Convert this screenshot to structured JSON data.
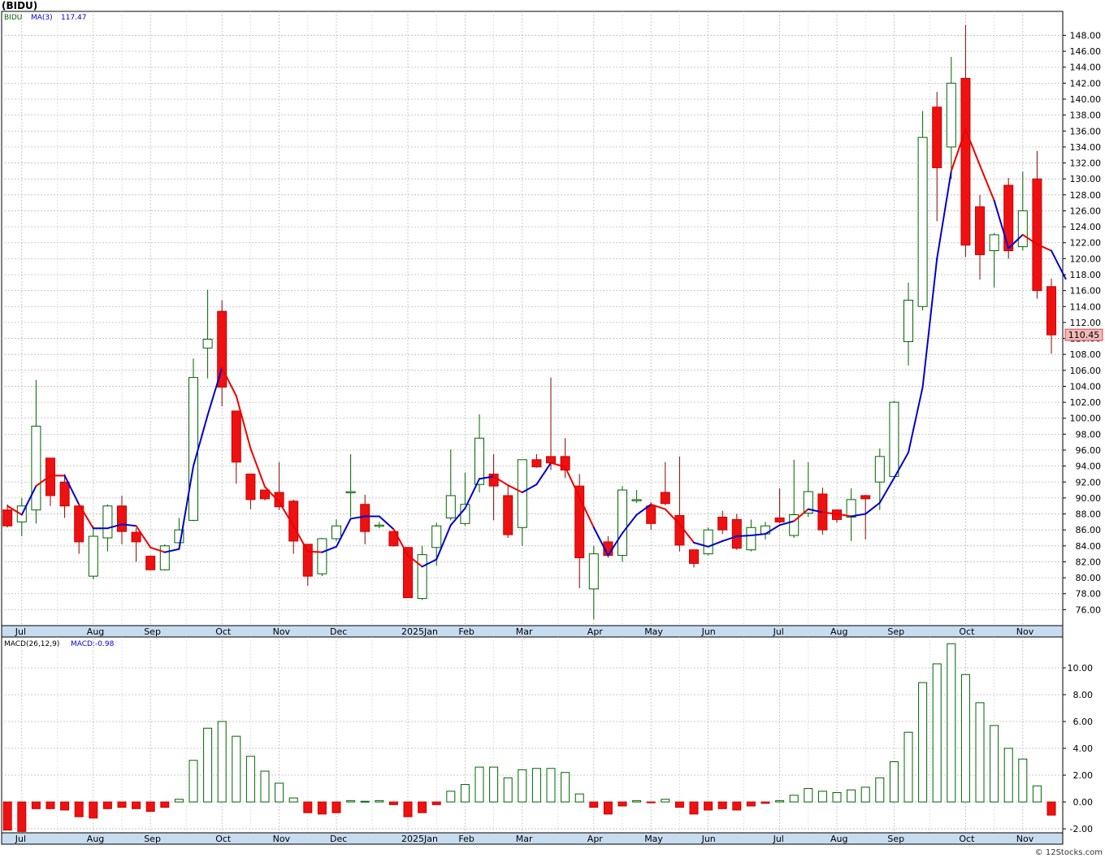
{
  "chart_data": [
    {
      "type": "candlestick",
      "title": "(BIDU)",
      "legend": [
        {
          "label": "BIDU",
          "color": "#006400"
        },
        {
          "label": "MA(3)",
          "color": "#0000cc"
        },
        {
          "label": "117.47",
          "color": "#0000cc"
        }
      ],
      "last_price_label": "110.45",
      "ylim": [
        74,
        151
      ],
      "yticks": [
        76,
        78,
        80,
        82,
        84,
        86,
        88,
        90,
        92,
        94,
        96,
        98,
        100,
        102,
        104,
        106,
        108,
        110,
        112,
        114,
        116,
        118,
        120,
        122,
        124,
        126,
        128,
        130,
        132,
        134,
        136,
        138,
        140,
        142,
        144,
        146,
        148
      ],
      "ytick_labels": [
        "76.00",
        "78.00",
        "80.00",
        "82.00",
        "84.00",
        "86.00",
        "88.00",
        "90.00",
        "92.00",
        "94.00",
        "96.00",
        "98.00",
        "100.00",
        "102.00",
        "104.00",
        "106.00",
        "108.00",
        "110.00",
        "112.00",
        "114.00",
        "116.00",
        "118.00",
        "120.00",
        "122.00",
        "124.00",
        "126.00",
        "128.00",
        "130.00",
        "132.00",
        "134.00",
        "136.00",
        "138.00",
        "140.00",
        "142.00",
        "144.00",
        "146.00",
        "148.00"
      ],
      "months": [
        {
          "label": "Jul",
          "index": 1
        },
        {
          "label": "Aug",
          "index": 6
        },
        {
          "label": "Sep",
          "index": 10
        },
        {
          "label": "Oct",
          "index": 15
        },
        {
          "label": "Nov",
          "index": 19
        },
        {
          "label": "Dec",
          "index": 23
        },
        {
          "label": "2025Jan",
          "index": 28
        },
        {
          "label": "Feb",
          "index": 32
        },
        {
          "label": "Mar",
          "index": 36
        },
        {
          "label": "Apr",
          "index": 41
        },
        {
          "label": "May",
          "index": 45
        },
        {
          "label": "Jun",
          "index": 49
        },
        {
          "label": "Jul",
          "index": 54
        },
        {
          "label": "Aug",
          "index": 58
        },
        {
          "label": "Sep",
          "index": 62
        },
        {
          "label": "Oct",
          "index": 67
        },
        {
          "label": "Nov",
          "index": 71
        }
      ],
      "candles": [
        {
          "o": 88.5,
          "h": 89.2,
          "l": 86.3,
          "c": 86.5
        },
        {
          "o": 87.0,
          "h": 90.0,
          "l": 85.2,
          "c": 89.0
        },
        {
          "o": 88.5,
          "h": 104.8,
          "l": 86.8,
          "c": 99.0
        },
        {
          "o": 95.0,
          "h": 95.0,
          "l": 89.0,
          "c": 90.3
        },
        {
          "o": 92.0,
          "h": 93.0,
          "l": 87.5,
          "c": 89.0
        },
        {
          "o": 89.0,
          "h": 89.2,
          "l": 83.0,
          "c": 84.5
        },
        {
          "o": 80.2,
          "h": 86.5,
          "l": 79.8,
          "c": 85.2
        },
        {
          "o": 85.0,
          "h": 89.2,
          "l": 83.3,
          "c": 89.0
        },
        {
          "o": 89.0,
          "h": 90.3,
          "l": 84.2,
          "c": 85.8
        },
        {
          "o": 85.7,
          "h": 86.2,
          "l": 82.0,
          "c": 84.5
        },
        {
          "o": 82.7,
          "h": 82.8,
          "l": 81.0,
          "c": 81.0
        },
        {
          "o": 81.0,
          "h": 84.2,
          "l": 80.9,
          "c": 84.0
        },
        {
          "o": 84.4,
          "h": 87.5,
          "l": 84.3,
          "c": 86.0
        },
        {
          "o": 87.2,
          "h": 107.5,
          "l": 87.1,
          "c": 105.1
        },
        {
          "o": 108.8,
          "h": 116.1,
          "l": 105.0,
          "c": 109.9
        },
        {
          "o": 113.4,
          "h": 114.8,
          "l": 101.5,
          "c": 103.9
        },
        {
          "o": 100.9,
          "h": 100.9,
          "l": 91.8,
          "c": 94.5
        },
        {
          "o": 93.0,
          "h": 93.0,
          "l": 88.6,
          "c": 89.8
        },
        {
          "o": 91.0,
          "h": 91.0,
          "l": 89.7,
          "c": 89.9
        },
        {
          "o": 90.7,
          "h": 94.5,
          "l": 88.5,
          "c": 88.9
        },
        {
          "o": 89.6,
          "h": 89.8,
          "l": 83.0,
          "c": 84.6
        },
        {
          "o": 84.2,
          "h": 84.2,
          "l": 79.0,
          "c": 80.2
        },
        {
          "o": 80.5,
          "h": 85.0,
          "l": 80.2,
          "c": 84.9
        },
        {
          "o": 84.9,
          "h": 87.3,
          "l": 84.6,
          "c": 86.5
        },
        {
          "o": 90.8,
          "h": 95.5,
          "l": 87.6,
          "c": 90.8
        },
        {
          "o": 89.2,
          "h": 90.4,
          "l": 84.2,
          "c": 85.8
        },
        {
          "o": 86.5,
          "h": 87.0,
          "l": 86.2,
          "c": 86.6
        },
        {
          "o": 85.8,
          "h": 85.8,
          "l": 83.9,
          "c": 84.0
        },
        {
          "o": 83.8,
          "h": 83.8,
          "l": 77.5,
          "c": 77.5
        },
        {
          "o": 77.4,
          "h": 84.0,
          "l": 77.2,
          "c": 82.9
        },
        {
          "o": 83.8,
          "h": 86.9,
          "l": 81.5,
          "c": 86.5
        },
        {
          "o": 87.5,
          "h": 96.1,
          "l": 87.2,
          "c": 90.3
        },
        {
          "o": 86.8,
          "h": 93.2,
          "l": 86.5,
          "c": 89.2
        },
        {
          "o": 91.7,
          "h": 100.5,
          "l": 90.7,
          "c": 97.5
        },
        {
          "o": 93.0,
          "h": 95.5,
          "l": 87.2,
          "c": 91.5
        },
        {
          "o": 90.3,
          "h": 91.5,
          "l": 85.0,
          "c": 85.4
        },
        {
          "o": 86.3,
          "h": 94.8,
          "l": 84.0,
          "c": 94.8
        },
        {
          "o": 94.8,
          "h": 95.5,
          "l": 93.8,
          "c": 93.9
        },
        {
          "o": 95.2,
          "h": 105.1,
          "l": 93.5,
          "c": 94.4
        },
        {
          "o": 95.2,
          "h": 97.5,
          "l": 92.5,
          "c": 93.5
        },
        {
          "o": 91.5,
          "h": 93.0,
          "l": 78.7,
          "c": 82.5
        },
        {
          "o": 78.6,
          "h": 84.0,
          "l": 74.8,
          "c": 83.0
        },
        {
          "o": 84.5,
          "h": 85.2,
          "l": 82.5,
          "c": 82.8
        },
        {
          "o": 82.8,
          "h": 91.5,
          "l": 82.0,
          "c": 91.0
        },
        {
          "o": 89.8,
          "h": 91.0,
          "l": 89.4,
          "c": 89.8
        },
        {
          "o": 89.0,
          "h": 89.5,
          "l": 86.0,
          "c": 86.8
        },
        {
          "o": 90.7,
          "h": 94.5,
          "l": 89.1,
          "c": 89.3
        },
        {
          "o": 87.8,
          "h": 95.2,
          "l": 83.3,
          "c": 84.1
        },
        {
          "o": 83.5,
          "h": 83.5,
          "l": 81.3,
          "c": 81.8
        },
        {
          "o": 83.0,
          "h": 86.3,
          "l": 82.8,
          "c": 86.0
        },
        {
          "o": 87.6,
          "h": 88.4,
          "l": 85.5,
          "c": 86.0
        },
        {
          "o": 87.3,
          "h": 88.0,
          "l": 83.5,
          "c": 83.7
        },
        {
          "o": 83.5,
          "h": 87.3,
          "l": 83.3,
          "c": 86.3
        },
        {
          "o": 85.5,
          "h": 87.0,
          "l": 84.8,
          "c": 86.5
        },
        {
          "o": 87.5,
          "h": 91.2,
          "l": 86.8,
          "c": 87.0
        },
        {
          "o": 85.3,
          "h": 94.8,
          "l": 85.0,
          "c": 87.9
        },
        {
          "o": 88.1,
          "h": 94.5,
          "l": 87.6,
          "c": 90.8
        },
        {
          "o": 90.5,
          "h": 91.3,
          "l": 85.4,
          "c": 86.0
        },
        {
          "o": 88.5,
          "h": 88.5,
          "l": 86.9,
          "c": 87.3
        },
        {
          "o": 87.6,
          "h": 91.2,
          "l": 84.6,
          "c": 89.8
        },
        {
          "o": 90.3,
          "h": 90.4,
          "l": 84.8,
          "c": 89.9
        },
        {
          "o": 92.0,
          "h": 96.2,
          "l": 88.5,
          "c": 95.2
        },
        {
          "o": 92.7,
          "h": 102.2,
          "l": 92.5,
          "c": 102.0
        },
        {
          "o": 109.6,
          "h": 117.0,
          "l": 106.6,
          "c": 114.8
        },
        {
          "o": 114.0,
          "h": 138.5,
          "l": 113.5,
          "c": 135.2
        },
        {
          "o": 139.0,
          "h": 140.9,
          "l": 124.7,
          "c": 131.4
        },
        {
          "o": 134.0,
          "h": 145.3,
          "l": 130.0,
          "c": 142.0
        },
        {
          "o": 142.6,
          "h": 149.3,
          "l": 120.2,
          "c": 121.7
        },
        {
          "o": 126.5,
          "h": 128.0,
          "l": 117.4,
          "c": 120.5
        },
        {
          "o": 121.0,
          "h": 123.2,
          "l": 116.4,
          "c": 123.0
        },
        {
          "o": 129.2,
          "h": 130.1,
          "l": 120.0,
          "c": 121.0
        },
        {
          "o": 121.5,
          "h": 130.9,
          "l": 121.0,
          "c": 126.0
        },
        {
          "o": 130.0,
          "h": 133.5,
          "l": 115.0,
          "c": 116.0
        },
        {
          "o": 116.5,
          "h": 117.5,
          "l": 108.1,
          "c": 110.45
        }
      ],
      "ma3": [
        89.0,
        87.9,
        91.5,
        92.8,
        92.8,
        89.2,
        86.2,
        86.2,
        86.7,
        86.5,
        83.8,
        83.2,
        83.6,
        94.0,
        100.4,
        106.3,
        102.8,
        96.2,
        91.4,
        89.5,
        86.5,
        83.3,
        83.2,
        83.9,
        87.4,
        87.7,
        87.7,
        86.1,
        82.8,
        81.4,
        82.3,
        86.6,
        88.7,
        92.4,
        92.7,
        91.6,
        90.7,
        91.7,
        94.4,
        93.9,
        90.1,
        86.3,
        82.8,
        85.6,
        87.9,
        89.2,
        88.6,
        86.7,
        84.4,
        83.9,
        84.6,
        85.2,
        85.3,
        85.5,
        86.6,
        87.1,
        88.6,
        88.2,
        88.0,
        87.7,
        88.0,
        89.4,
        92.5,
        95.7,
        103.9,
        120.0,
        131.0,
        136.2,
        131.7,
        127.3,
        121.3,
        123.0,
        121.8,
        121.0,
        117.47
      ],
      "ma3_colors": "RBRRBRBBBRRBBBBRRRRRRRBBBBBRRBBBBBRRBBRRRBBBBRRRBBBBBBBRBRRBBBBBBBRRRBBRR"
    },
    {
      "type": "bar",
      "title": "MACD(26,12,9)",
      "legend": [
        {
          "label": "MACD(26,12,9)",
          "color": "#000000"
        },
        {
          "label": "MACD:-0.98",
          "color": "#0000cc"
        }
      ],
      "ylim": [
        -2.3,
        12.3
      ],
      "yticks": [
        -2,
        0,
        2,
        4,
        6,
        8,
        10
      ],
      "ytick_labels": [
        "-2.00",
        "0.00",
        "2.00",
        "4.00",
        "6.00",
        "8.00",
        "10.00"
      ],
      "values": [
        -2.1,
        -2.2,
        -0.5,
        -0.5,
        -0.6,
        -1.1,
        -1.2,
        -0.5,
        -0.4,
        -0.5,
        -0.7,
        -0.4,
        0.2,
        3.1,
        5.5,
        6.0,
        4.9,
        3.4,
        2.3,
        1.4,
        0.3,
        -0.8,
        -0.9,
        -0.8,
        0.1,
        0.05,
        0.1,
        -0.2,
        -1.1,
        -0.8,
        -0.2,
        0.8,
        1.3,
        2.6,
        2.6,
        1.8,
        2.4,
        2.5,
        2.5,
        2.2,
        0.6,
        -0.4,
        -0.9,
        -0.3,
        0.1,
        -0.05,
        0.2,
        -0.4,
        -0.9,
        -0.6,
        -0.5,
        -0.6,
        -0.3,
        -0.1,
        0.1,
        0.5,
        1.0,
        0.8,
        0.7,
        0.9,
        1.1,
        1.8,
        3.0,
        5.2,
        8.9,
        10.3,
        11.8,
        9.5,
        7.4,
        5.7,
        4.0,
        3.2,
        1.2,
        -0.98
      ]
    }
  ],
  "footer": "© 12Stocks.com"
}
